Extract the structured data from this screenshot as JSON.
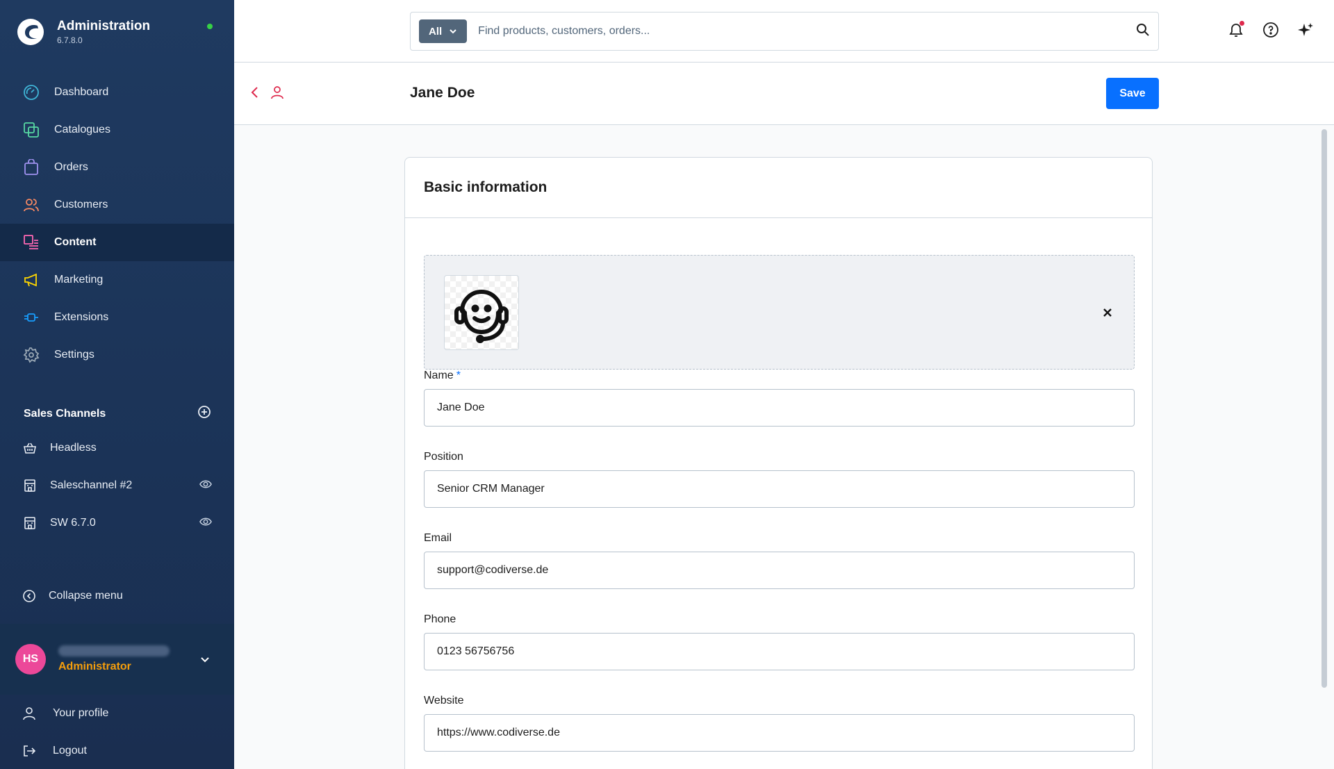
{
  "app": {
    "title": "Administration",
    "version": "6.7.8.0"
  },
  "nav": [
    {
      "label": "Dashboard",
      "icon": "dashboard-icon",
      "color": "#3fb5d7"
    },
    {
      "label": "Catalogues",
      "icon": "catalogues-icon",
      "color": "#57d9a3"
    },
    {
      "label": "Orders",
      "icon": "orders-icon",
      "color": "#a092f0"
    },
    {
      "label": "Customers",
      "icon": "customers-icon",
      "color": "#f88962"
    },
    {
      "label": "Content",
      "icon": "content-icon",
      "color": "#ff68b4",
      "active": true
    },
    {
      "label": "Marketing",
      "icon": "marketing-icon",
      "color": "#ffd700"
    },
    {
      "label": "Extensions",
      "icon": "extensions-icon",
      "color": "#189eff"
    },
    {
      "label": "Settings",
      "icon": "settings-icon",
      "color": "#9aa8b5"
    }
  ],
  "sales_channels": {
    "title": "Sales Channels",
    "items": [
      {
        "label": "Headless",
        "icon": "basket-icon",
        "visible_toggle": false
      },
      {
        "label": "Saleschannel #2",
        "icon": "storefront-icon",
        "visible_toggle": true
      },
      {
        "label": "SW 6.7.0",
        "icon": "storefront-icon",
        "visible_toggle": true
      }
    ]
  },
  "collapse_label": "Collapse menu",
  "user": {
    "initials": "HS",
    "role": "Administrator"
  },
  "user_menu": [
    "Your profile",
    "Logout"
  ],
  "search": {
    "type_label": "All",
    "placeholder": "Find products, customers, orders..."
  },
  "page": {
    "title": "Jane Doe",
    "save_label": "Save"
  },
  "card": {
    "title": "Basic information",
    "fields": {
      "name": {
        "label": "Name",
        "required": "*",
        "value": "Jane Doe"
      },
      "position": {
        "label": "Position",
        "value": "Senior CRM Manager"
      },
      "email": {
        "label": "Email",
        "value": "support@codiverse.de"
      },
      "phone": {
        "label": "Phone",
        "value": "0123 56756756"
      },
      "website": {
        "label": "Website",
        "value": "https://www.codiverse.de"
      }
    }
  },
  "colors": {
    "accent": "#0870ff",
    "sidebar": "#1f3a60",
    "avatar": "#ec4899",
    "role": "#f59e0b"
  }
}
